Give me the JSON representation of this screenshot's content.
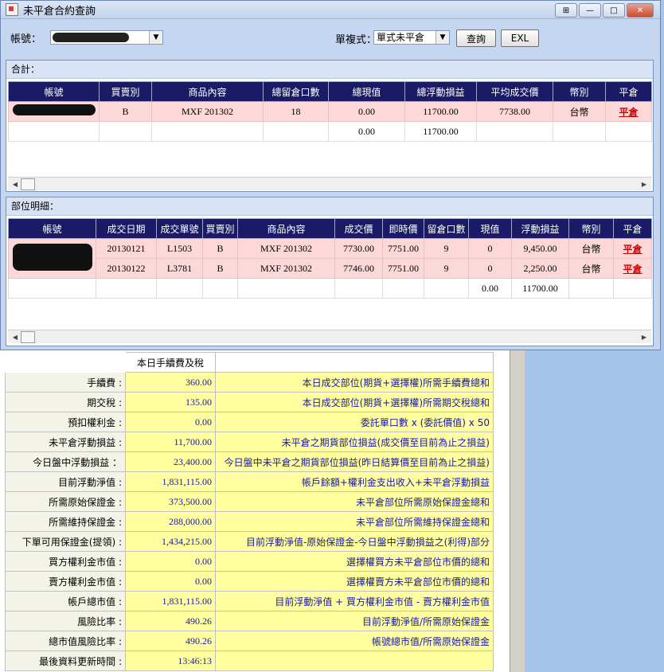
{
  "window": {
    "title": "未平倉合約查詢"
  },
  "toolbar": {
    "account_label": "帳號：",
    "mode_label": "單複式：",
    "mode_value": "單式未平倉",
    "query_button": "查詢",
    "exl_button": "EXL"
  },
  "summary": {
    "title": "合計：",
    "columns": [
      "帳號",
      "買賣別",
      "商品內容",
      "總留倉口數",
      "總現值",
      "總浮動損益",
      "平均成交價",
      "幣別",
      "平倉"
    ],
    "rows": [
      {
        "account": "",
        "side": "B",
        "product": "MXF 201302",
        "qty": "18",
        "value": "0.00",
        "pnl": "11700.00",
        "avg_price": "7738.00",
        "currency": "台幣",
        "action": "平倉"
      },
      {
        "account": "",
        "side": "",
        "product": "",
        "qty": "",
        "value": "0.00",
        "pnl": "11700.00",
        "avg_price": "",
        "currency": "",
        "action": ""
      }
    ]
  },
  "detail": {
    "title": "部位明細：",
    "columns": [
      "帳號",
      "成交日期",
      "成交單號",
      "買賣別",
      "商品內容",
      "成交價",
      "即時價",
      "留倉口數",
      "現值",
      "浮動損益",
      "幣別",
      "平倉"
    ],
    "rows": [
      {
        "account": "",
        "date": "20130121",
        "order": "L1503",
        "side": "B",
        "product": "MXF 201302",
        "price": "7730.00",
        "live": "7751.00",
        "qty": "9",
        "value": "0",
        "pnl": "9,450.00",
        "currency": "台幣",
        "action": "平倉"
      },
      {
        "account": "",
        "date": "20130122",
        "order": "L3781",
        "side": "B",
        "product": "MXF 201302",
        "price": "7746.00",
        "live": "7751.00",
        "qty": "9",
        "value": "0",
        "pnl": "2,250.00",
        "currency": "台幣",
        "action": "平倉"
      },
      {
        "account": "",
        "date": "",
        "order": "",
        "side": "",
        "product": "",
        "price": "",
        "live": "",
        "qty": "",
        "value": "0.00",
        "pnl": "11700.00",
        "currency": "",
        "action": ""
      }
    ]
  },
  "fees": {
    "header": "本日手續費及稅",
    "rows": [
      {
        "label": "手續費 :",
        "value": "360.00",
        "desc": "本日成交部位(期貨+選擇權)所需手續費總和"
      },
      {
        "label": "期交稅 :",
        "value": "135.00",
        "desc": "本日成交部位(期貨+選擇權)所需期交稅總和"
      },
      {
        "label": "預扣權利金 :",
        "value": "0.00",
        "desc": "委託單口數 x (委託價值) x 50"
      },
      {
        "label": "未平倉浮動損益 :",
        "value": "11,700.00",
        "desc": "未平倉之期貨部位損益(成交價至目前為止之損益)"
      },
      {
        "label": "今日盤中浮動損益 ：",
        "value": "23,400.00",
        "desc": "今日盤中未平倉之期貨部位損益(昨日結算價至目前為止之損益)"
      },
      {
        "label": "目前浮動淨值 :",
        "value": "1,831,115.00",
        "desc": "帳戶餘額+權利金支出收入+未平倉浮動損益"
      },
      {
        "label": "所需原始保證金 :",
        "value": "373,500.00",
        "desc": "未平倉部位所需原始保證金總和"
      },
      {
        "label": "所需維持保證金 :",
        "value": "288,000.00",
        "desc": "未平倉部位所需維持保證金總和"
      },
      {
        "label": "下單可用保證金(提領) :",
        "value": "1,434,215.00",
        "desc": "目前浮動淨值-原始保證金-今日盤中浮動損益之(利得)部分"
      },
      {
        "label": "買方權利金市值 :",
        "value": "0.00",
        "desc": "選擇權買方未平倉部位市價的總和"
      },
      {
        "label": "賣方權利金市值 :",
        "value": "0.00",
        "desc": "選擇權賣方未平倉部位市價的總和"
      },
      {
        "label": "帳戶總市值 :",
        "value": "1,831,115.00",
        "desc": "目前浮動淨值 + 買方權利金市值 - 賣方權利金市值"
      },
      {
        "label": "風險比率 :",
        "value": "490.26",
        "desc": "目前浮動淨值/所需原始保證金"
      },
      {
        "label": "總市值風險比率 :",
        "value": "490.26",
        "desc": "帳號總市值/所需原始保證金"
      },
      {
        "label": "最後資料更新時間 :",
        "value": "13:46:13",
        "desc": ""
      }
    ]
  }
}
